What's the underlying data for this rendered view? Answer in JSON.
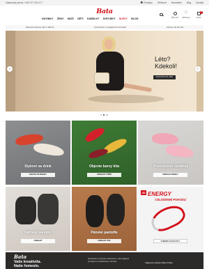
{
  "topbar": {
    "phone": "Zákaznický servis: +420 377 000 177",
    "links": [
      "Prodejny",
      "Oblíbené",
      "Newsletter",
      "Blog",
      "Kontakt"
    ]
  },
  "header": {
    "logo": "Bata",
    "nav": [
      "NOVINKY",
      "ŽENY",
      "MUŽI",
      "DĚTI",
      "KABELKY",
      "DOPLŇKY",
      "SLEVY",
      "BLOG"
    ],
    "icons": {
      "account": "Můj účet",
      "wishlist": "Oblíbené",
      "cart": "Košík",
      "cart_count": "0"
    }
  },
  "promo": [
    "Doprava zdarma nad 1 499 Kč",
    "Vyzvednutí v prodejně do 24 hodin",
    "Vrácení do 60 dnů"
  ],
  "hero": {
    "title_line1": "Léto?",
    "title_line2": "Kdekoli!",
    "button": "NAKUPUJTE ZDE",
    "arrow_left": "‹",
    "arrow_right": "›"
  },
  "tiles": [
    {
      "label": "Stylové na drink",
      "cta": "NAKUPUJTE MODELY"
    },
    {
      "label": "Objevte barvy léta",
      "cta": "ZOBRAZIT VÝBĚR"
    },
    {
      "label": "Provzdušné roztáhky",
      "cta": "ZOBRAZIT MODELY"
    },
    {
      "label": "Dámské sandály",
      "cta": "ZOBRAZIT"
    },
    {
      "label": "Pánské pantofle",
      "cta": "ZOBRAZIT VÍCE"
    },
    {
      "label": "",
      "cta": "VYBERTE SI SVŮJ STYL"
    }
  ],
  "energy": {
    "badge": "3D",
    "title": "ENERGY",
    "subtitle": "CELODENNÍ POHODLÍ"
  },
  "banner": {
    "logo": "Bata",
    "headline1": "Vaše kreativita.",
    "headline2": "Naše řemeslo.",
    "mid_text": "Navrhněte si svůj pár exkluzivně v naší vlajkové prodejně na Václavském náměstí",
    "right_text": "Vlajková prodejna Bata Praha"
  }
}
